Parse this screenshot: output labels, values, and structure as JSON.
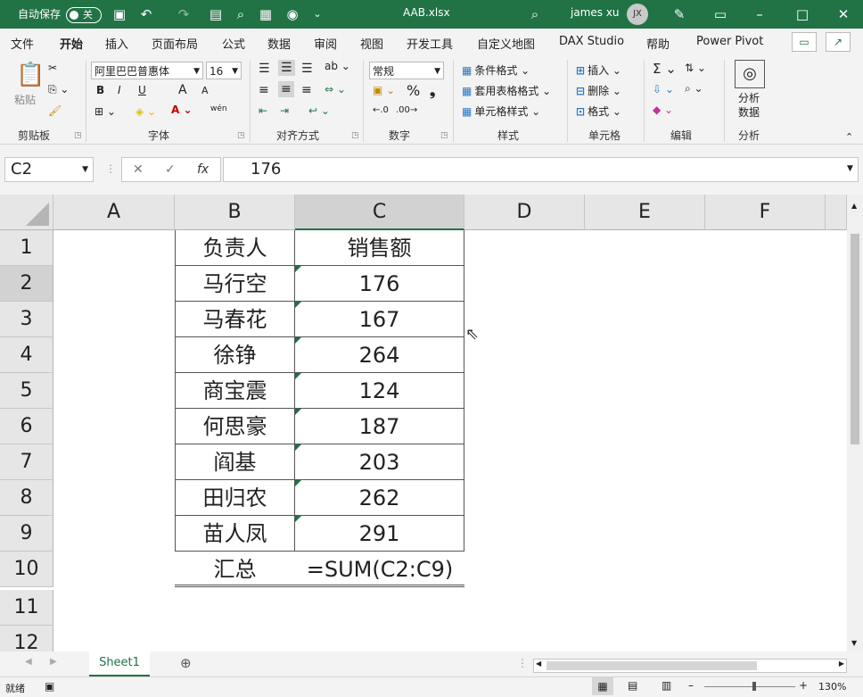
{
  "titlebar": {
    "autosave_label": "自动保存",
    "autosave_state": "关",
    "filename": "AAB.xlsx",
    "user_name": "james xu",
    "user_initials": "JX"
  },
  "tabs": [
    "文件",
    "开始",
    "插入",
    "页面布局",
    "公式",
    "数据",
    "审阅",
    "视图",
    "开发工具",
    "自定义地图",
    "DAX Studio",
    "帮助",
    "Power Pivot"
  ],
  "active_tab": "开始",
  "ribbon": {
    "clipboard": {
      "paste": "粘贴",
      "label": "剪贴板"
    },
    "font": {
      "name": "阿里巴巴普惠体",
      "size": "16",
      "label": "字体",
      "bold": "B",
      "italic": "I",
      "underline": "U",
      "grow": "A",
      "shrink": "A",
      "phonetic": "wén"
    },
    "alignment": {
      "label": "对齐方式"
    },
    "number": {
      "format": "常规",
      "label": "数字",
      "percent": "%"
    },
    "styles": {
      "conditional": "条件格式",
      "table": "套用表格格式",
      "cell": "单元格样式",
      "label": "样式"
    },
    "cells": {
      "insert": "插入",
      "delete": "删除",
      "format": "格式",
      "label": "单元格"
    },
    "editing": {
      "label": "编辑"
    },
    "analysis": {
      "button_line1": "分析",
      "button_line2": "数据",
      "label": "分析"
    }
  },
  "formula_bar": {
    "name_box": "C2",
    "fx": "fx",
    "content": "176"
  },
  "columns": [
    "A",
    "B",
    "C",
    "D",
    "E",
    "F"
  ],
  "rows": [
    "1",
    "2",
    "3",
    "4",
    "5",
    "6",
    "7",
    "8",
    "9",
    "10",
    "11",
    "12"
  ],
  "table": {
    "header": [
      "负责人",
      "销售额"
    ],
    "data": [
      [
        "马行空",
        "176"
      ],
      [
        "马春花",
        "167"
      ],
      [
        "徐铮",
        "264"
      ],
      [
        "商宝震",
        "124"
      ],
      [
        "何思豪",
        "187"
      ],
      [
        "阎基",
        "203"
      ],
      [
        "田归农",
        "262"
      ],
      [
        "苗人凤",
        "291"
      ]
    ],
    "total_label": "汇总",
    "total_formula": "=SUM(C2:C9)"
  },
  "sheet_tab": "Sheet1",
  "status": {
    "ready": "就绪",
    "zoom": "130%"
  }
}
